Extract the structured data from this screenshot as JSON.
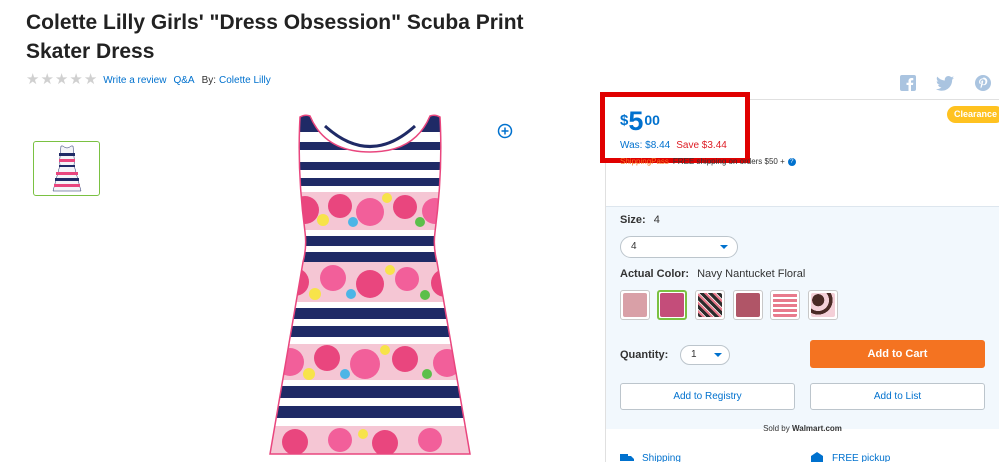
{
  "product": {
    "title": "Colette Lilly Girls' \"Dress Obsession\" Scuba Print Skater Dress",
    "write_review": "Write a review",
    "qa": "Q&A",
    "by_label": "By:",
    "brand": "Colette Lilly",
    "rating_stars": 0
  },
  "share": {
    "icons": [
      "facebook-icon",
      "twitter-icon",
      "pinterest-icon"
    ]
  },
  "price": {
    "currency": "$",
    "dollars": "5",
    "cents": "00",
    "was": "Was: $8.44",
    "save": "Save $3.44",
    "badge": "Clearance"
  },
  "shipping": {
    "pass": "ShippingPass",
    "free_text": "FREE shipping on orders $50 +"
  },
  "options": {
    "size_label": "Size:",
    "size_value": "4",
    "size_selected": "4",
    "color_label": "Actual Color:",
    "color_value": "Navy Nantucket Floral",
    "swatch_colors": [
      "#d9a0a7",
      "#c44d7a",
      "#2b2b2b",
      "#b05567",
      "#e87a8c",
      "#4a2a25"
    ]
  },
  "purchase": {
    "quantity_label": "Quantity:",
    "quantity_value": "1",
    "add_to_cart": "Add to Cart",
    "add_to_registry": "Add to Registry",
    "add_to_list": "Add to List",
    "sold_by_label": "Sold by",
    "sold_by": "Walmart.com"
  },
  "fulfillment": {
    "shipping": "Shipping",
    "pickup": "FREE pickup"
  },
  "colors": {
    "brand_blue": "#0071ce",
    "cart_orange": "#f47321",
    "clearance_yellow": "#ffc220",
    "highlight_red": "#e00000",
    "save_red": "#de1c24"
  }
}
